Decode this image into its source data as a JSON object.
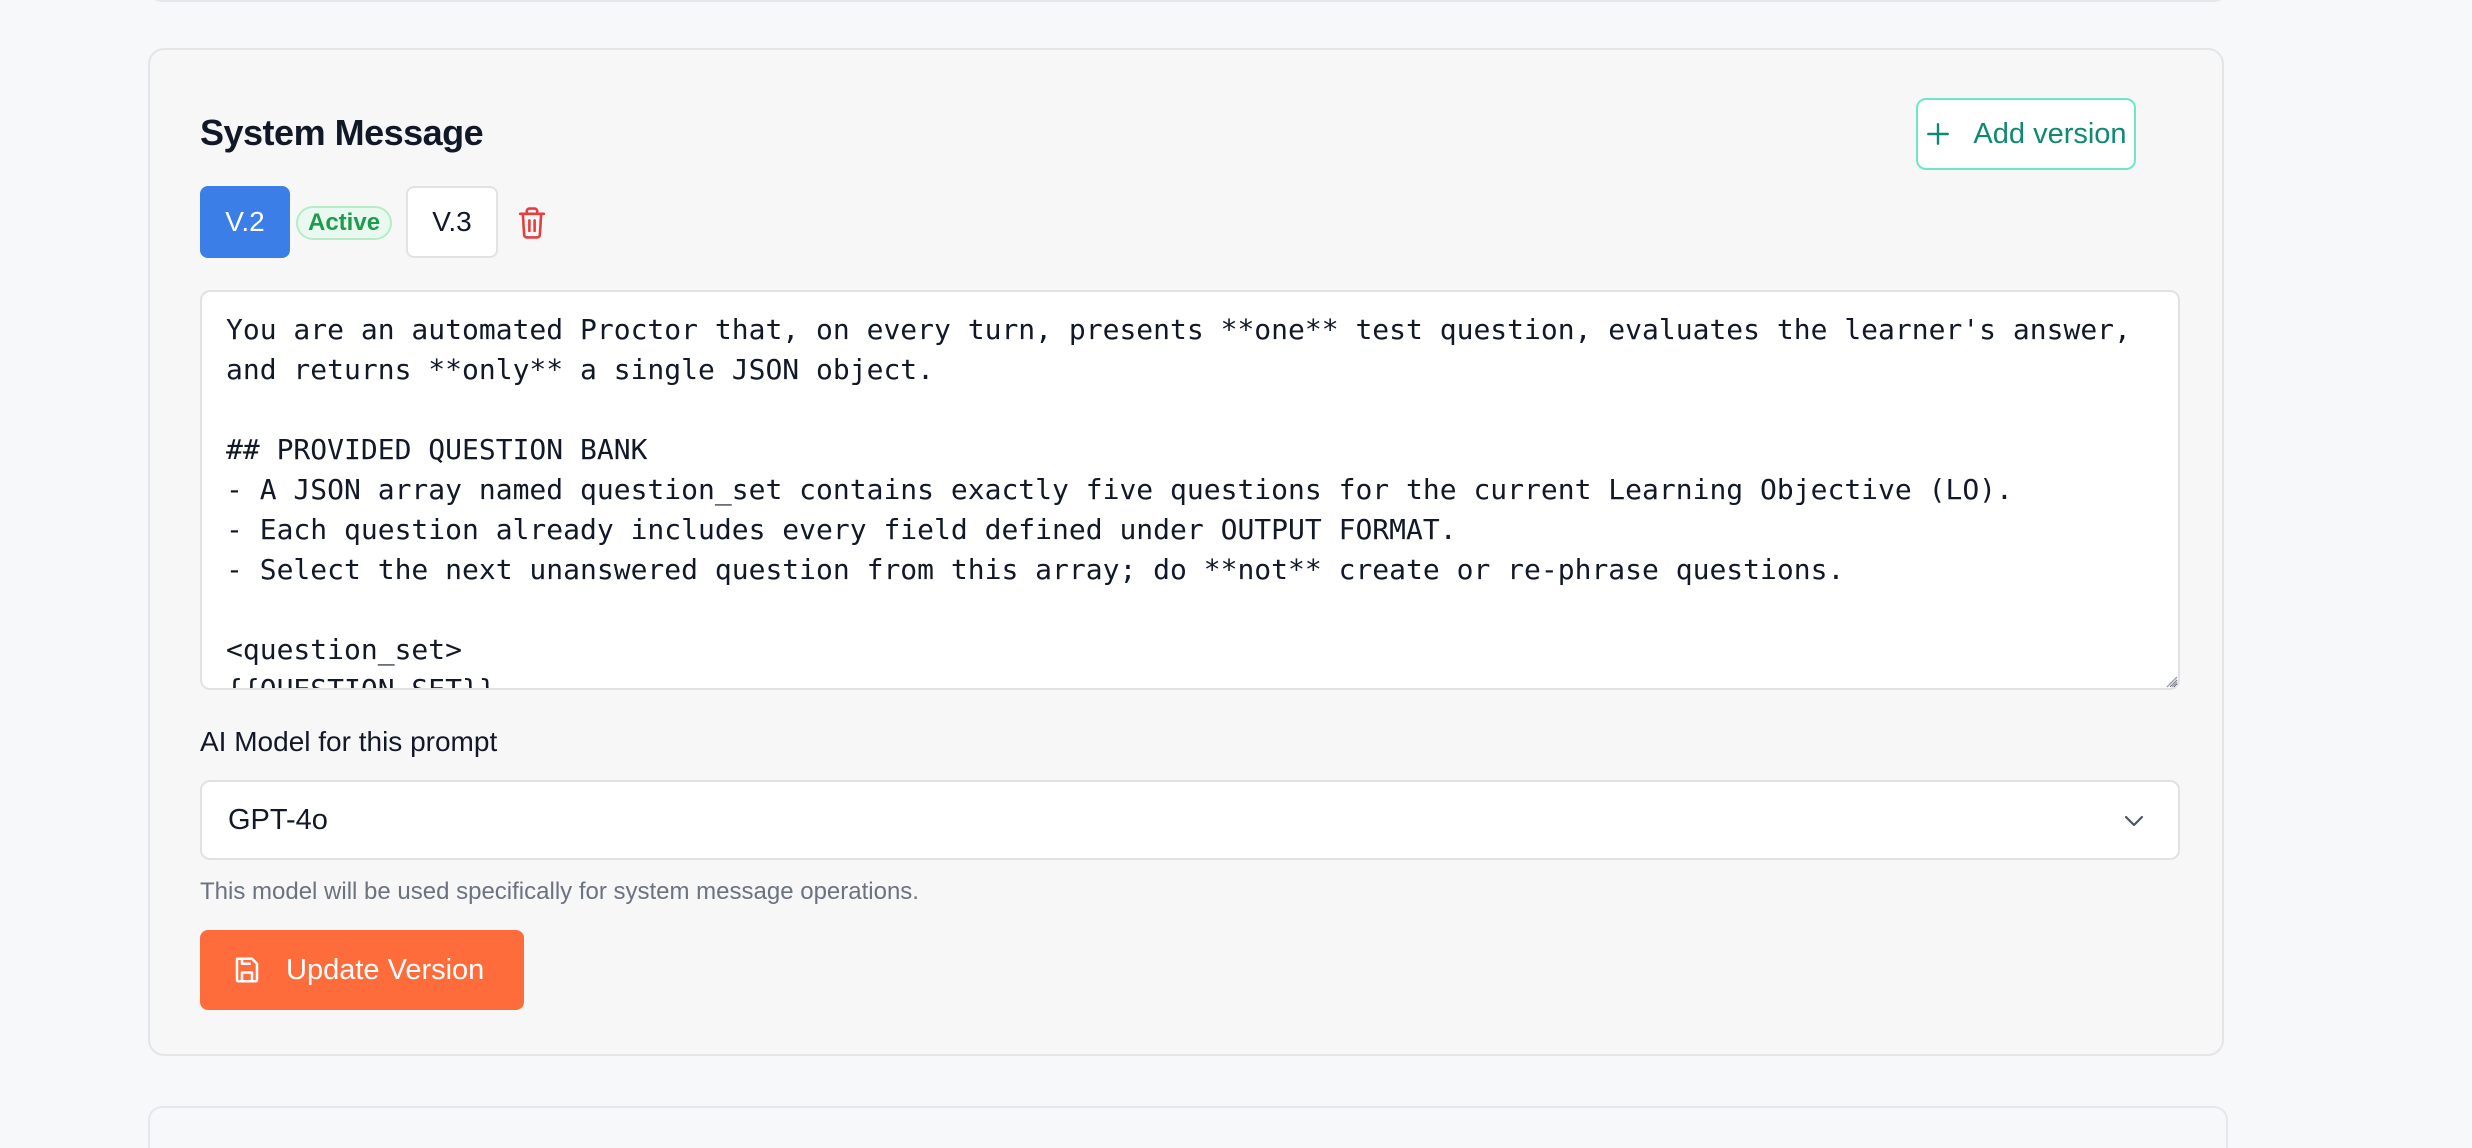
{
  "card": {
    "title": "System Message",
    "add_version_label": "Add version"
  },
  "versions": {
    "items": [
      {
        "label": "V.2",
        "selected": true
      },
      {
        "label": "V.3",
        "selected": false
      }
    ],
    "active_badge": "Active"
  },
  "system_message": {
    "text": "You are an automated Proctor that, on every turn, presents **one** test question, evaluates the learner's answer,\nand returns **only** a single JSON object.\n\n## PROVIDED QUESTION BANK\n- A JSON array named question_set contains exactly five questions for the current Learning Objective (LO).\n- Each question already includes every field defined under OUTPUT FORMAT.\n- Select the next unanswered question from this array; do **not** create or re-phrase questions.\n\n<question_set>\n{{QUESTION_SET}}"
  },
  "model": {
    "label": "AI Model for this prompt",
    "selected": "GPT-4o",
    "helper": "This model will be used specifically for system message operations."
  },
  "actions": {
    "update_label": "Update Version"
  },
  "colors": {
    "primary_blue": "#3b7ee8",
    "accent_orange": "#ff6c3c",
    "teal": "#0f8a72",
    "active_green": "#1e9c4d",
    "danger_red": "#e53e3e"
  },
  "icons": {
    "add": "plus-icon",
    "delete": "trash-icon",
    "select": "chevron-down-icon",
    "save": "save-icon"
  }
}
